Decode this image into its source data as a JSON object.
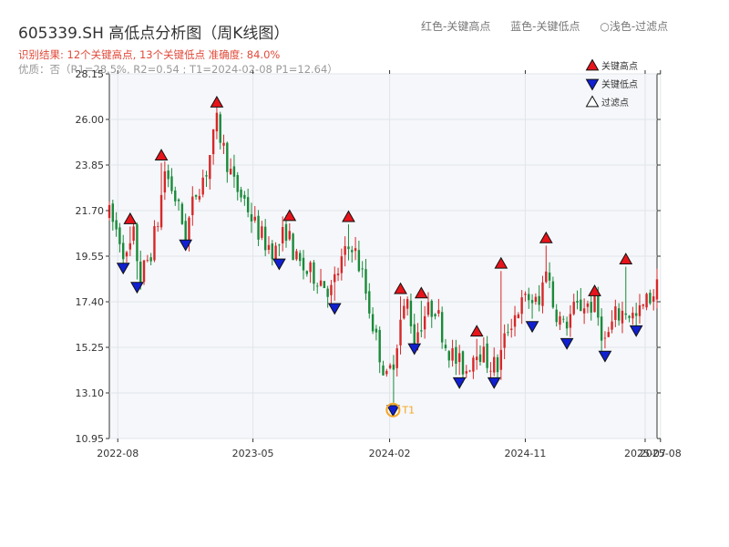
{
  "header": {
    "title": "605339.SH 高低点分析图（周K线图）",
    "legend_red": "红色-关键高点",
    "legend_blue": "蓝色-关键低点",
    "legend_gray": "浅色-过滤点",
    "result_line": "识别结果: 12个关键高点, 13个关键低点   准确度: 84.0%",
    "quality_line": "优质：否（R1=28.5%, R2=0.54 ; T1=2024-02-08 P1=12.64）"
  },
  "colors": {
    "up": "#d62728",
    "down": "#1a8a3a",
    "high": "#e8141b",
    "low": "#1020d0",
    "t1": "#f5a623",
    "plot_bg": "#f5f7fa"
  },
  "chart_data": {
    "type": "candlestick",
    "xlabel": "",
    "ylabel": "",
    "ylim": [
      10.95,
      28.15
    ],
    "yticks": [
      10.95,
      13.1,
      15.25,
      17.4,
      19.55,
      21.7,
      23.85,
      26.0,
      28.15
    ],
    "ytick_labels": [
      "10.95",
      "13.10",
      "15.25",
      "17.40",
      "19.55",
      "21.70",
      "23.85",
      "26.00",
      "28.15"
    ],
    "x_range": [
      "2022-07-15",
      "2025-07-25"
    ],
    "xticks": [
      "2022-08-01",
      "2023-05-01",
      "2024-02-01",
      "2024-11-01",
      "2025-07-01",
      "2025-08-01"
    ],
    "xtick_labels": [
      "2022-08",
      "2023-05",
      "2024-02",
      "2024-11",
      "2025-07",
      "2025-08"
    ],
    "grid": true,
    "legend": [
      "关键高点",
      "关键低点",
      "过滤点"
    ],
    "legend_position": "top-right",
    "anchors": [
      [
        "2022-07-15",
        21.5
      ],
      [
        "2022-08-05",
        20.4
      ],
      [
        "2022-08-19",
        19.4
      ],
      [
        "2022-09-02",
        20.5
      ],
      [
        "2022-09-16",
        18.5
      ],
      [
        "2022-10-07",
        19.8
      ],
      [
        "2022-10-21",
        21.2
      ],
      [
        "2022-11-04",
        23.6
      ],
      [
        "2022-11-25",
        22.3
      ],
      [
        "2022-12-16",
        20.6
      ],
      [
        "2023-01-06",
        22.6
      ],
      [
        "2023-01-27",
        23.6
      ],
      [
        "2023-02-17",
        25.8
      ],
      [
        "2023-03-03",
        24.6
      ],
      [
        "2023-03-24",
        22.9
      ],
      [
        "2023-04-14",
        22.2
      ],
      [
        "2023-05-05",
        21.0
      ],
      [
        "2023-05-26",
        20.2
      ],
      [
        "2023-06-16",
        19.8
      ],
      [
        "2023-07-07",
        20.8
      ],
      [
        "2023-07-28",
        19.3
      ],
      [
        "2023-08-18",
        18.8
      ],
      [
        "2023-09-08",
        18.6
      ],
      [
        "2023-10-06",
        17.9
      ],
      [
        "2023-10-27",
        19.3
      ],
      [
        "2023-11-17",
        20.2
      ],
      [
        "2023-12-08",
        18.6
      ],
      [
        "2024-01-05",
        15.6
      ],
      [
        "2024-01-26",
        13.7
      ],
      [
        "2024-02-08",
        14.6
      ],
      [
        "2024-02-23",
        16.5
      ],
      [
        "2024-03-08",
        17.4
      ],
      [
        "2024-03-22",
        15.7
      ],
      [
        "2024-04-12",
        16.8
      ],
      [
        "2024-05-03",
        17.2
      ],
      [
        "2024-05-24",
        15.4
      ],
      [
        "2024-06-14",
        14.6
      ],
      [
        "2024-07-05",
        14.2
      ],
      [
        "2024-07-26",
        15.3
      ],
      [
        "2024-08-16",
        14.6
      ],
      [
        "2024-09-06",
        14.3
      ],
      [
        "2024-09-27",
        16.2
      ],
      [
        "2024-10-18",
        17.1
      ],
      [
        "2024-11-08",
        17.6
      ],
      [
        "2024-11-29",
        17.2
      ],
      [
        "2024-12-13",
        19.2
      ],
      [
        "2024-12-27",
        17.3
      ],
      [
        "2025-01-17",
        16.2
      ],
      [
        "2025-02-07",
        17.0
      ],
      [
        "2025-02-28",
        17.3
      ],
      [
        "2025-03-21",
        17.2
      ],
      [
        "2025-04-11",
        15.5
      ],
      [
        "2025-05-02",
        16.7
      ],
      [
        "2025-05-23",
        17.0
      ],
      [
        "2025-06-13",
        16.6
      ],
      [
        "2025-07-04",
        17.4
      ],
      [
        "2025-07-25",
        18.1
      ]
    ],
    "key_highs": [
      {
        "date": "2022-08-26",
        "price": 20.95
      },
      {
        "date": "2022-10-28",
        "price": 23.95
      },
      {
        "date": "2023-02-17",
        "price": 26.45
      },
      {
        "date": "2023-07-14",
        "price": 21.1
      },
      {
        "date": "2023-11-10",
        "price": 21.05
      },
      {
        "date": "2024-02-23",
        "price": 17.65
      },
      {
        "date": "2024-04-05",
        "price": 17.45
      },
      {
        "date": "2024-07-26",
        "price": 15.65
      },
      {
        "date": "2024-09-13",
        "price": 18.85
      },
      {
        "date": "2024-12-13",
        "price": 20.05
      },
      {
        "date": "2025-03-21",
        "price": 17.55
      },
      {
        "date": "2025-05-23",
        "price": 19.05
      }
    ],
    "key_lows": [
      {
        "date": "2022-08-12",
        "price": 19.35
      },
      {
        "date": "2022-09-09",
        "price": 18.45
      },
      {
        "date": "2022-12-16",
        "price": 20.45
      },
      {
        "date": "2023-06-23",
        "price": 19.55
      },
      {
        "date": "2023-10-13",
        "price": 17.45
      },
      {
        "date": "2024-02-08",
        "price": 12.64
      },
      {
        "date": "2024-03-22",
        "price": 15.55
      },
      {
        "date": "2024-06-21",
        "price": 13.95
      },
      {
        "date": "2024-08-30",
        "price": 13.95
      },
      {
        "date": "2024-11-15",
        "price": 16.6
      },
      {
        "date": "2025-01-24",
        "price": 15.8
      },
      {
        "date": "2025-04-11",
        "price": 15.2
      },
      {
        "date": "2025-06-13",
        "price": 16.4
      }
    ],
    "t1": {
      "date": "2024-02-08",
      "price": 12.64,
      "label": "T1"
    }
  }
}
